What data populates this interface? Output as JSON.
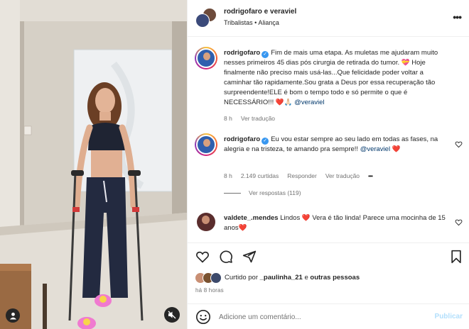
{
  "header": {
    "names": "rodrigofaro e veraviel",
    "subtitle": "Tribalistas • Aliança",
    "more_icon": "more-horizontal-icon"
  },
  "comments": [
    {
      "user": "rodrigofaro",
      "verified": true,
      "text_a": "Fim de mais uma etapa. As muletas me ajudaram muito nesses primeiros 45 dias pós cirurgia de retirada do tumor. ",
      "emoji_a": "💝",
      "text_b": " Hoje finalmente não preciso mais usá-las...Que felicidade poder voltar a caminhar tão rapidamente.Sou grata a Deus por essa recuperação tão surpreendente!ELE é bom o tempo todo e só permite o que é NECESSÁRIO!!! ",
      "emoji_b": "❤️🙏🏻",
      "mention": "@veraviel",
      "time": "8 h",
      "translate": "Ver tradução"
    },
    {
      "user": "rodrigofaro",
      "verified": true,
      "text": "Eu vou estar sempre ao seu lado em todas as fases, na alegria e na tristeza, te amando pra sempre!!",
      "mention": "@veraviel",
      "emoji": "❤️",
      "time": "8 h",
      "likes": "2.149 curtidas",
      "reply": "Responder",
      "translate": "Ver tradução",
      "more": "•••",
      "view_replies": "Ver respostas (119)"
    },
    {
      "user": "valdete_.mendes",
      "text_a": "Lindos ",
      "emoji_a": "❤️",
      "text_b": " Vera é tão linda! Parece uma mocinha de 15 anos",
      "emoji_b": "❤️"
    }
  ],
  "actions": {
    "icons": [
      "heart-icon",
      "comment-icon",
      "share-icon",
      "bookmark-icon"
    ],
    "liked_prefix": "Curtido por ",
    "liked_user": "_paulinha_21",
    "liked_mid": " e ",
    "liked_others": "outras pessoas",
    "time_ago": "há 8 horas"
  },
  "add_comment": {
    "placeholder": "Adicione um comentário...",
    "publish": "Publicar"
  },
  "colors": {
    "verified": "#3897f0",
    "heart": "#ed4956",
    "publish_disabled": "#b2dffc",
    "meta_gray": "#737373"
  }
}
